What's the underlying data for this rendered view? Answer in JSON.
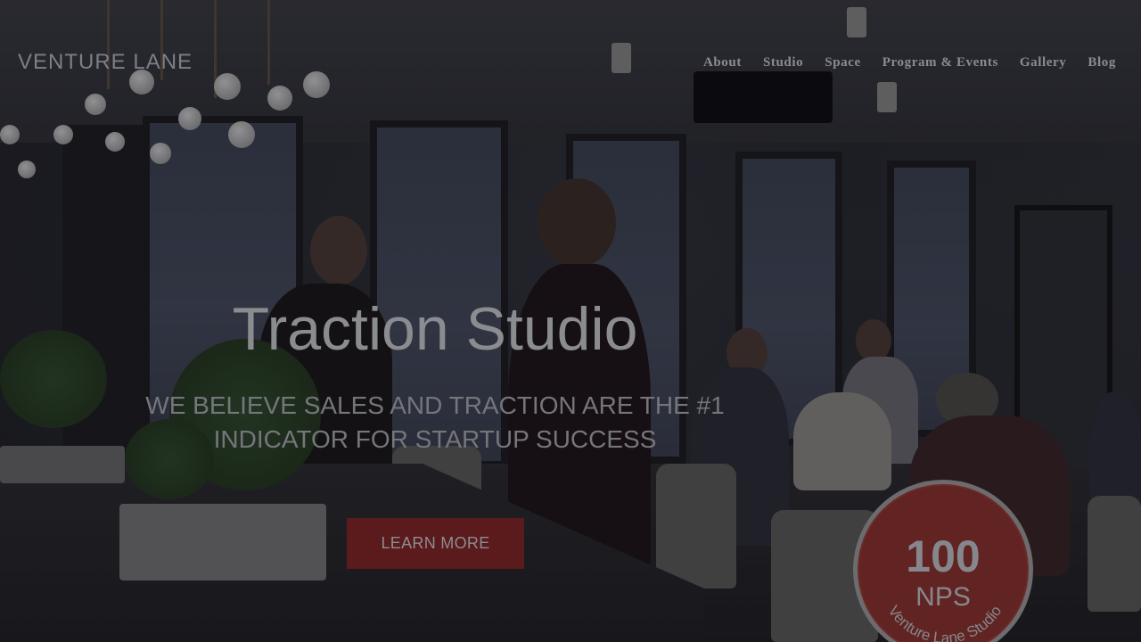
{
  "brand": {
    "logo_text": "VENTURE LANE"
  },
  "nav": {
    "items": [
      {
        "label": "About"
      },
      {
        "label": "Studio"
      },
      {
        "label": "Space"
      },
      {
        "label": "Program & Events"
      },
      {
        "label": "Gallery"
      },
      {
        "label": "Blog"
      }
    ]
  },
  "hero": {
    "title": "Traction Studio",
    "tagline_line1": "WE BELIEVE SALES AND TRACTION ARE THE #1",
    "tagline_line2": "INDICATOR FOR STARTUP SUCCESS",
    "cta_label": "LEARN MORE"
  },
  "badge": {
    "number": "100",
    "label": "NPS",
    "arc_text": "Venture Lane Studio"
  },
  "colors": {
    "accent": "#5b1a1b",
    "badge_fill": "#612423",
    "text_muted": "#8a8c93"
  }
}
